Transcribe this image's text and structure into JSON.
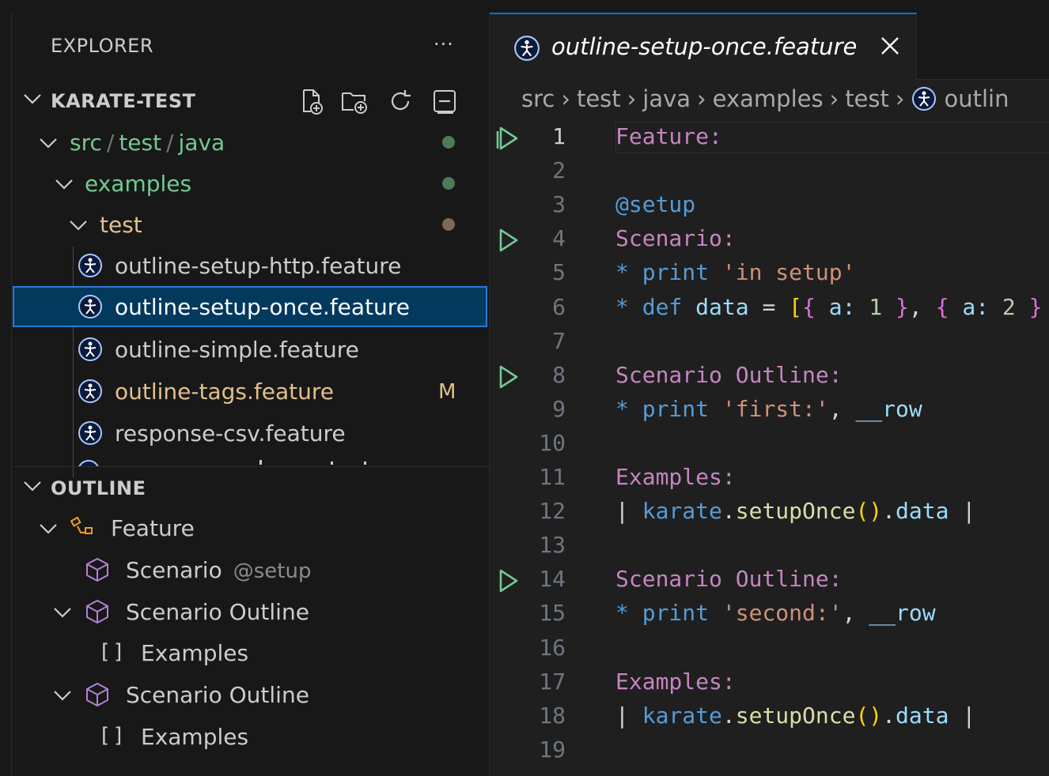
{
  "explorer": {
    "title": "EXPLORER",
    "more": "···",
    "section": "KARATE-TEST",
    "folders": [
      {
        "parts": [
          "src",
          "test",
          "java"
        ]
      },
      {
        "label": "examples"
      },
      {
        "label": "test"
      }
    ],
    "files": [
      {
        "label": "outline-setup-http.feature",
        "badge": ""
      },
      {
        "label": "outline-setup-once.feature",
        "badge": ""
      },
      {
        "label": "outline-simple.feature",
        "badge": ""
      },
      {
        "label": "outline-tags.feature",
        "badge": "M"
      },
      {
        "label": "response-csv.feature",
        "badge": ""
      }
    ]
  },
  "outline": {
    "title": "OUTLINE",
    "items": [
      {
        "label": "Feature",
        "desc": ""
      },
      {
        "label": "Scenario",
        "desc": "@setup"
      },
      {
        "label": "Scenario Outline",
        "desc": ""
      },
      {
        "label": "Examples",
        "desc": ""
      },
      {
        "label": "Scenario Outline",
        "desc": ""
      },
      {
        "label": "Examples",
        "desc": ""
      }
    ]
  },
  "editor": {
    "tab": "outline-setup-once.feature",
    "breadcrumbs": [
      "src",
      "test",
      "java",
      "examples",
      "test",
      "outlin"
    ],
    "lines": [
      {
        "n": "1",
        "tokens": [
          {
            "t": "Feature:",
            "c": "#c586c0"
          }
        ]
      },
      {
        "n": "2",
        "tokens": []
      },
      {
        "n": "3",
        "tokens": [
          {
            "t": "@setup",
            "c": "#569cd6"
          }
        ]
      },
      {
        "n": "4",
        "tokens": [
          {
            "t": "Scenario:",
            "c": "#c586c0"
          }
        ]
      },
      {
        "n": "5",
        "tokens": [
          {
            "t": "* ",
            "c": "#569cd6"
          },
          {
            "t": "print",
            "c": "#569cd6"
          },
          {
            "t": " ",
            "c": "#cccccc"
          },
          {
            "t": "'in setup'",
            "c": "#ce9178"
          }
        ]
      },
      {
        "n": "6",
        "tokens": [
          {
            "t": "* ",
            "c": "#569cd6"
          },
          {
            "t": "def",
            "c": "#569cd6"
          },
          {
            "t": " ",
            "c": "#cccccc"
          },
          {
            "t": "data",
            "c": "#9cdcfe"
          },
          {
            "t": " = ",
            "c": "#d4d4d4"
          },
          {
            "t": "[",
            "c": "#ffd700"
          },
          {
            "t": "{",
            "c": "#da70d6"
          },
          {
            "t": " a: ",
            "c": "#9cdcfe"
          },
          {
            "t": "1",
            "c": "#b5cea8"
          },
          {
            "t": " }",
            "c": "#da70d6"
          },
          {
            "t": ", ",
            "c": "#d4d4d4"
          },
          {
            "t": "{",
            "c": "#da70d6"
          },
          {
            "t": " a: ",
            "c": "#9cdcfe"
          },
          {
            "t": "2",
            "c": "#b5cea8"
          },
          {
            "t": " }",
            "c": "#da70d6"
          }
        ]
      },
      {
        "n": "7",
        "tokens": []
      },
      {
        "n": "8",
        "tokens": [
          {
            "t": "Scenario Outline:",
            "c": "#c586c0"
          }
        ]
      },
      {
        "n": "9",
        "tokens": [
          {
            "t": "* ",
            "c": "#569cd6"
          },
          {
            "t": "print",
            "c": "#569cd6"
          },
          {
            "t": " ",
            "c": "#cccccc"
          },
          {
            "t": "'first:'",
            "c": "#ce9178"
          },
          {
            "t": ", ",
            "c": "#d4d4d4"
          },
          {
            "t": "__row",
            "c": "#9cdcfe"
          }
        ]
      },
      {
        "n": "10",
        "tokens": []
      },
      {
        "n": "11",
        "tokens": [
          {
            "t": "Examples:",
            "c": "#c586c0"
          }
        ]
      },
      {
        "n": "12",
        "tokens": [
          {
            "t": "| ",
            "c": "#d4d4d4"
          },
          {
            "t": "karate",
            "c": "#569cd6"
          },
          {
            "t": ".",
            "c": "#d4d4d4"
          },
          {
            "t": "setupOnce",
            "c": "#dcdcaa"
          },
          {
            "t": "()",
            "c": "#ffd700"
          },
          {
            "t": ".",
            "c": "#d4d4d4"
          },
          {
            "t": "data",
            "c": "#9cdcfe"
          },
          {
            "t": " |",
            "c": "#d4d4d4"
          }
        ]
      },
      {
        "n": "13",
        "tokens": []
      },
      {
        "n": "14",
        "tokens": [
          {
            "t": "Scenario Outline:",
            "c": "#c586c0"
          }
        ]
      },
      {
        "n": "15",
        "tokens": [
          {
            "t": "* ",
            "c": "#569cd6"
          },
          {
            "t": "print",
            "c": "#569cd6"
          },
          {
            "t": " ",
            "c": "#cccccc"
          },
          {
            "t": "'second:'",
            "c": "#ce9178"
          },
          {
            "t": ", ",
            "c": "#d4d4d4"
          },
          {
            "t": "__row",
            "c": "#9cdcfe"
          }
        ]
      },
      {
        "n": "16",
        "tokens": []
      },
      {
        "n": "17",
        "tokens": [
          {
            "t": "Examples:",
            "c": "#c586c0"
          }
        ]
      },
      {
        "n": "18",
        "tokens": [
          {
            "t": "| ",
            "c": "#d4d4d4"
          },
          {
            "t": "karate",
            "c": "#569cd6"
          },
          {
            "t": ".",
            "c": "#d4d4d4"
          },
          {
            "t": "setupOnce",
            "c": "#dcdcaa"
          },
          {
            "t": "()",
            "c": "#ffd700"
          },
          {
            "t": ".",
            "c": "#d4d4d4"
          },
          {
            "t": "data",
            "c": "#9cdcfe"
          },
          {
            "t": " |",
            "c": "#d4d4d4"
          }
        ]
      },
      {
        "n": "19",
        "tokens": []
      }
    ],
    "run_lines": [
      "1",
      "4",
      "8",
      "14"
    ],
    "active_line": "1"
  },
  "colors": {
    "folder_green": "#73c991",
    "folder_yellow": "#e2c08d",
    "modified": "#e2c08d",
    "run_icon": "#73c991",
    "keyword": "#c586c0",
    "selection": "#04395e",
    "focus_border": "#2b79d8"
  }
}
